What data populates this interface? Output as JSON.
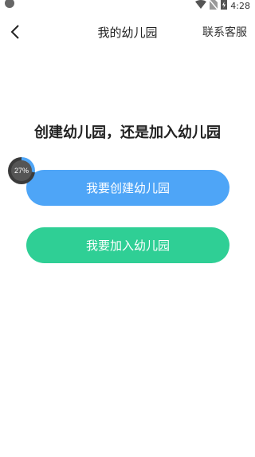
{
  "status_bar": {
    "time": "4:28",
    "icons": [
      "camera-dot",
      "wifi-icon",
      "no-sim-icon",
      "battery-charging-icon"
    ]
  },
  "nav": {
    "back_icon": "chevron-left-icon",
    "title": "我的幼儿园",
    "action": "联系客服"
  },
  "main": {
    "headline": "创建幼儿园，还是加入幼儿园",
    "create_button": "我要创建幼儿园",
    "join_button": "我要加入幼儿园"
  },
  "progress_badge": {
    "label": "27%",
    "value": 0.27
  },
  "colors": {
    "create_button": "#4ea5f7",
    "join_button": "#2fcf95"
  }
}
